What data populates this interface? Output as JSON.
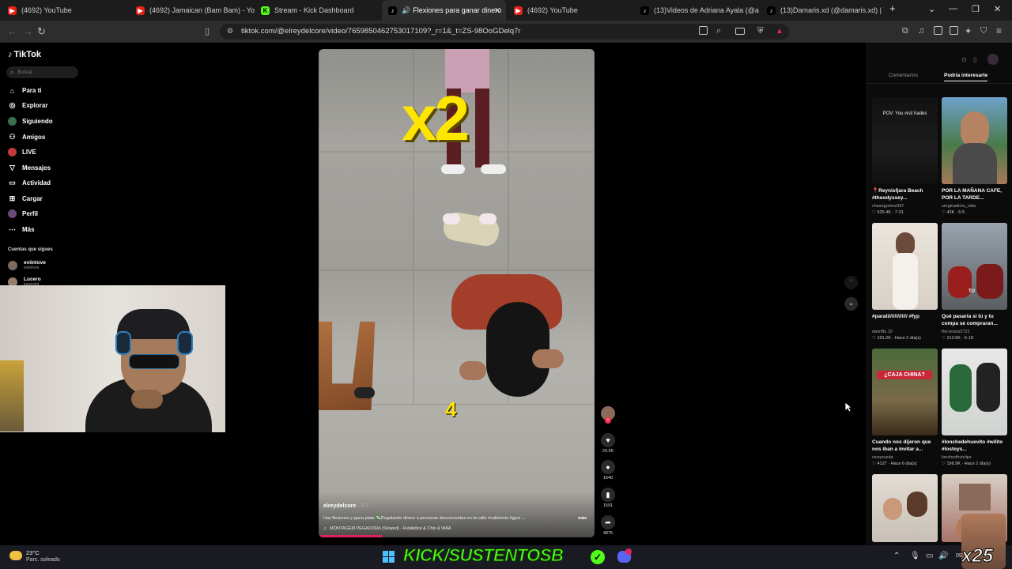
{
  "browser": {
    "tabs": [
      {
        "label": "(4692) YouTube",
        "icon": "youtube-icon",
        "active": false
      },
      {
        "label": "(4692) Jamaican (Bam Bam) - YouTube",
        "icon": "youtube-icon",
        "active": false
      },
      {
        "label": "Stream - Kick Dashboard",
        "icon": "kick-icon",
        "active": false
      },
      {
        "label": "Flexiones para ganar dinero",
        "icon": "tiktok-icon",
        "active": true
      },
      {
        "label": "(4692) YouTube",
        "icon": "youtube-icon",
        "active": false
      },
      {
        "label": "(13)Videos de Adriana Ayala (@adr",
        "icon": "tiktok-icon",
        "active": false
      },
      {
        "label": "(13)Damaris.xd (@damaris.xd) | TikT",
        "icon": "tiktok-icon",
        "active": false
      }
    ],
    "url": "tiktok.com/@elreydelcore/video/7659850462753017109?_r=1&_t=ZS-98OoGDelq7r"
  },
  "tiktok": {
    "logo": "TikTok",
    "search_placeholder": "Buscar",
    "nav": [
      {
        "label": "Para ti",
        "icon": "home-icon"
      },
      {
        "label": "Explorar",
        "icon": "compass-icon"
      },
      {
        "label": "Siguiendo",
        "icon": "following-icon"
      },
      {
        "label": "Amigos",
        "icon": "friends-icon"
      },
      {
        "label": "LIVE",
        "icon": "live-icon"
      },
      {
        "label": "Mensajes",
        "icon": "messages-icon"
      },
      {
        "label": "Actividad",
        "icon": "activity-icon"
      },
      {
        "label": "Cargar",
        "icon": "upload-icon"
      },
      {
        "label": "Perfil",
        "icon": "profile-icon"
      },
      {
        "label": "Más",
        "icon": "more-icon"
      }
    ],
    "following_header": "Cuentas que sigues",
    "following": [
      {
        "name": "eviinlove",
        "handle": "eviinlove"
      },
      {
        "name": "Lucero",
        "handle": "lucerohd"
      }
    ]
  },
  "video": {
    "overlay_big": "x2",
    "overlay_count": "4",
    "author": "elreydelcore",
    "date": "7-7",
    "caption": "Haz flexiones y gana plata 💸Regalando dinero a personas desconocidas en la calle #callelonia #gyre ...",
    "caption_more": "más",
    "music": "MONTAGEM PEGADORA (Slowed) - Rubikdice & Chlx & WAA",
    "likes": "29.5K",
    "comments": "1640",
    "saves": "1591",
    "shares": "4875"
  },
  "panel": {
    "tabs": [
      "Comentarios",
      "Podría interesarte"
    ],
    "videos": [
      {
        "overlay": "POV: You visit hades",
        "caption": "📍Reynisfjara Beach #theodyssey...",
        "user": "chasegomez997",
        "stats": "625.4K · 7-31"
      },
      {
        "overlay": "",
        "caption": "POR LA MAÑANA CAFE, POR LA TARDE...",
        "user": "sergioadicto_vida",
        "stats": "43K · 6-5"
      },
      {
        "overlay": "",
        "caption": "#parati///////////// #fyp",
        "user": "danrifts.10",
        "stats": "191.2K · Hace 2 día(s)"
      },
      {
        "overlay": "TU",
        "caption": "Qué pasaría si tú y tu compa se compraran...",
        "user": "the.bosss2721",
        "stats": "212.6K · 6-18"
      },
      {
        "overlay": "¿CAJA CHINA?",
        "caption": "Cuando nos dijeron que nos iban a invitar a...",
        "user": "viveyrueda",
        "stats": "4127 · Hace 6 día(s)"
      },
      {
        "overlay": "",
        "caption": "#lonchedehuevito #wilito #lostoys...",
        "user": "lonchedhvtclips",
        "stats": "196.9K · Hace 2 día(s)"
      }
    ]
  },
  "taskbar": {
    "temp": "23°C",
    "weather": "Parc. soleado",
    "banner": "KICK/SUSTENTOSB",
    "multiplier": "x25",
    "clock_partial": "09"
  }
}
